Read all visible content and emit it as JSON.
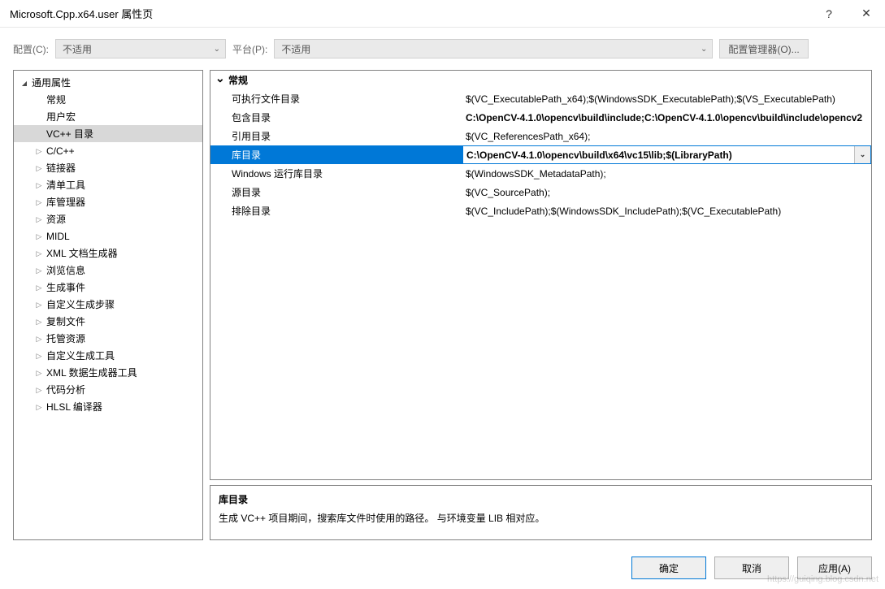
{
  "window": {
    "title": "Microsoft.Cpp.x64.user 属性页",
    "help_tooltip": "?",
    "close_tooltip": "✕"
  },
  "config_bar": {
    "config_label": "配置(C):",
    "config_value": "不适用",
    "platform_label": "平台(P):",
    "platform_value": "不适用",
    "config_mgr_label": "配置管理器(O)..."
  },
  "tree": {
    "root": "通用属性",
    "items": [
      {
        "label": "常规",
        "expandable": false
      },
      {
        "label": "用户宏",
        "expandable": false
      },
      {
        "label": "VC++ 目录",
        "expandable": false,
        "selected": true
      },
      {
        "label": "C/C++",
        "expandable": true
      },
      {
        "label": "链接器",
        "expandable": true
      },
      {
        "label": "清单工具",
        "expandable": true
      },
      {
        "label": "库管理器",
        "expandable": true
      },
      {
        "label": "资源",
        "expandable": true
      },
      {
        "label": "MIDL",
        "expandable": true
      },
      {
        "label": "XML 文档生成器",
        "expandable": true
      },
      {
        "label": "浏览信息",
        "expandable": true
      },
      {
        "label": "生成事件",
        "expandable": true
      },
      {
        "label": "自定义生成步骤",
        "expandable": true
      },
      {
        "label": "复制文件",
        "expandable": true
      },
      {
        "label": "托管资源",
        "expandable": true
      },
      {
        "label": "自定义生成工具",
        "expandable": true
      },
      {
        "label": "XML 数据生成器工具",
        "expandable": true
      },
      {
        "label": "代码分析",
        "expandable": true
      },
      {
        "label": "HLSL 编译器",
        "expandable": true
      }
    ]
  },
  "grid": {
    "category": "常规",
    "rows": [
      {
        "name": "可执行文件目录",
        "value": "$(VC_ExecutablePath_x64);$(WindowsSDK_ExecutablePath);$(VS_ExecutablePath)",
        "bold": false
      },
      {
        "name": "包含目录",
        "value": "C:\\OpenCV-4.1.0\\opencv\\build\\include;C:\\OpenCV-4.1.0\\opencv\\build\\include\\opencv2",
        "bold": true
      },
      {
        "name": "引用目录",
        "value": "$(VC_ReferencesPath_x64);",
        "bold": false
      },
      {
        "name": "库目录",
        "value": "C:\\OpenCV-4.1.0\\opencv\\build\\x64\\vc15\\lib;$(LibraryPath)",
        "bold": true,
        "selected": true
      },
      {
        "name": "Windows 运行库目录",
        "value": "$(WindowsSDK_MetadataPath);",
        "bold": false
      },
      {
        "name": "源目录",
        "value": "$(VC_SourcePath);",
        "bold": false
      },
      {
        "name": "排除目录",
        "value": "$(VC_IncludePath);$(WindowsSDK_IncludePath);$(VC_ExecutablePath)",
        "bold": false
      }
    ]
  },
  "description": {
    "title": "库目录",
    "text": "生成 VC++ 项目期间，搜索库文件时使用的路径。 与环境变量 LIB 相对应。"
  },
  "buttons": {
    "ok": "确定",
    "cancel": "取消",
    "apply": "应用(A)"
  },
  "watermark": "https://guiqing.blog.csdn.net"
}
